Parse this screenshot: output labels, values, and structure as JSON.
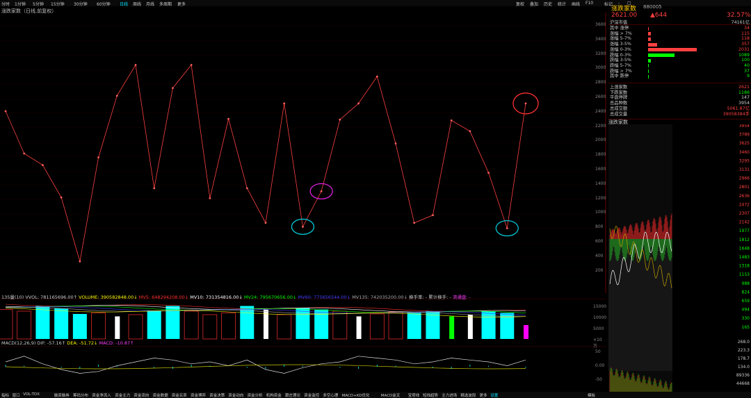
{
  "topbar": {
    "left_items": [
      "分时",
      "1分钟",
      "5分钟",
      "15分钟",
      "30分钟",
      "60分钟",
      "日线",
      "周线",
      "月线",
      "多周期",
      "更多"
    ],
    "right_items": [
      "复权",
      "叠加",
      "历史",
      "统计",
      "画线",
      "F10",
      "标记",
      "-",
      "□"
    ],
    "active_item": "日线"
  },
  "chart_title": "涨跌家数（日线,前复权）",
  "right_axis_ticks": [
    "3600",
    "3400",
    "3200",
    "3000",
    "2800",
    "2600",
    "2400",
    "2200",
    "2000",
    "1800",
    "1600",
    "1400",
    "1200",
    "1000",
    "800",
    "600",
    "400",
    "200"
  ],
  "chart_data": {
    "type": "line",
    "y": [
      2500,
      1950,
      1800,
      1380,
      550,
      1900,
      2700,
      3100,
      1500,
      2800,
      3100,
      1370,
      2400,
      1500,
      1050,
      2600,
      1000,
      1460,
      2390,
      2600,
      2950,
      2080,
      1050,
      1150,
      2380,
      2240,
      1700,
      980,
      2600
    ],
    "ylim": [
      400,
      3600
    ],
    "highlights": [
      {
        "index": 16,
        "color": "#00c8d8"
      },
      {
        "index": 17,
        "color": "#e020e0"
      },
      {
        "index": 27,
        "color": "#00c8d8"
      },
      {
        "index": 28,
        "color": "#ff3030"
      }
    ]
  },
  "volume": {
    "legend": [
      {
        "text": "135量(10)",
        "color": "#cccccc"
      },
      {
        "text": "VVOL: 781165696.00↑",
        "color": "#cccccc"
      },
      {
        "text": "VOLUME: 390582848.00↓",
        "color": "#ffff00"
      },
      {
        "text": "MV5: 648294208.00↓",
        "color": "#ff3030"
      },
      {
        "text": "MV10: 731354816.00↓",
        "color": "#ffffff"
      },
      {
        "text": "MV24: 795670656.00↓",
        "color": "#00ff00"
      },
      {
        "text": "MV60: 775656544.00↓",
        "color": "#4040ff"
      },
      {
        "text": "MV135: 742035200.00↓",
        "color": "#aaaaaa"
      },
      {
        "text": "换手率: -",
        "color": "#cccccc"
      },
      {
        "text": "累计换手: -",
        "color": "#cccccc"
      },
      {
        "text": "流通盘: -",
        "color": "#ff40ff"
      }
    ],
    "bars": [
      {
        "t": "red"
      },
      {
        "t": "red"
      },
      {
        "t": "cyan"
      },
      {
        "t": "cyan"
      },
      {
        "t": "cyan"
      },
      {
        "t": "red"
      },
      {
        "t": "white"
      },
      {
        "t": "red"
      },
      {
        "t": "cyan"
      },
      {
        "t": "cyan"
      },
      {
        "t": "red"
      },
      {
        "t": "red"
      },
      {
        "t": "red"
      },
      {
        "t": "cyan"
      },
      {
        "t": "white"
      },
      {
        "t": "red"
      },
      {
        "t": "cyan"
      },
      {
        "t": "cyan"
      },
      {
        "t": "red"
      },
      {
        "t": "white"
      },
      {
        "t": "red"
      },
      {
        "t": "red"
      },
      {
        "t": "cyan"
      },
      {
        "t": "cyan"
      },
      {
        "t": "green"
      },
      {
        "t": "white"
      },
      {
        "t": "cyan"
      },
      {
        "t": "cyan"
      },
      {
        "t": "magenta"
      }
    ],
    "heights": [
      0.85,
      0.8,
      0.95,
      0.88,
      0.72,
      0.75,
      0.65,
      0.7,
      0.82,
      0.95,
      0.8,
      0.7,
      0.75,
      0.95,
      0.85,
      0.7,
      0.9,
      0.85,
      0.8,
      0.65,
      0.72,
      0.78,
      0.75,
      0.8,
      0.65,
      0.7,
      0.8,
      0.75,
      0.4
    ],
    "axis_ticks": [
      "15000",
      "10000",
      "5000",
      "×10万"
    ]
  },
  "macd": {
    "legend": [
      {
        "text": "MACD(12,26,9) DIF: -57.16↑",
        "color": "#cccccc"
      },
      {
        "text": "DEA: -51.72↓",
        "color": "#ffff00"
      },
      {
        "text": "MACD: -10.87↑",
        "color": "#ff40ff"
      }
    ],
    "dif": [
      40,
      55,
      35,
      20,
      10,
      15,
      30,
      40,
      50,
      45,
      35,
      40,
      30,
      45,
      20,
      10,
      25,
      35,
      40,
      55,
      50,
      45,
      35,
      40,
      50,
      45,
      40,
      30,
      45
    ],
    "axis_ticks": [
      "50",
      "0.00",
      "-50"
    ]
  },
  "right_panel": {
    "name": "涨跌家数",
    "code": "880005",
    "price": "2621.00",
    "change": "▲644",
    "pct": "32.57%",
    "market_cap_label": "沪深市值",
    "market_cap_value": "74161亿",
    "rows": [
      {
        "label": "其中 涨停",
        "value": "34",
        "color": "#ff4040",
        "bar": 0.02
      },
      {
        "label": "涨幅 > 7%",
        "value": "115",
        "color": "#ff4040",
        "bar": 0.06
      },
      {
        "label": "涨幅 5-7%",
        "value": "118",
        "color": "#ff4040",
        "bar": 0.06
      },
      {
        "label": "涨幅 3-5%",
        "value": "357",
        "color": "#ff4040",
        "bar": 0.18
      },
      {
        "label": "涨幅 0-3%",
        "value": "2031",
        "color": "#ff4040",
        "bar": 1.0
      },
      {
        "label": "跌幅 0-3%",
        "value": "1089",
        "color": "#00ff00",
        "bar": 0.54
      },
      {
        "label": "跌幅 3-5%",
        "value": "100",
        "color": "#00ff00",
        "bar": 0.05
      },
      {
        "label": "跌幅 5-7%",
        "value": "40",
        "color": "#00ff00",
        "bar": 0.02
      },
      {
        "label": "跌幅 > 7%",
        "value": "37",
        "color": "#00ff00",
        "bar": 0.02
      },
      {
        "label": "其中 跌停",
        "value": "9",
        "color": "#00ff00",
        "bar": 0.005
      }
    ],
    "stats": [
      {
        "label": "上涨家数",
        "value": "2621",
        "color": "#ff4040"
      },
      {
        "label": "下跌家数",
        "value": "1186",
        "color": "#00ff00"
      },
      {
        "label": "平盘停牌",
        "value": "147",
        "color": "#cccccc"
      },
      {
        "label": "总品种数",
        "value": "3954",
        "color": "#cccccc"
      },
      {
        "label": "总成交额",
        "value": "5061.87亿",
        "color": "#ff4040"
      },
      {
        "label": "总成交量",
        "value": "39058384手",
        "color": "#ff4040"
      }
    ],
    "mini_title": "涨跌家数",
    "mini_axis": [
      "3954",
      "3789",
      "3625",
      "3460",
      "3295",
      "3131",
      "2966",
      "2801",
      "2636",
      "2472",
      "2307",
      "2142",
      "1977",
      "1812",
      "1648",
      "1483",
      "1318",
      "1153",
      "988",
      "824",
      "659",
      "494",
      "330",
      "165"
    ],
    "mini_axis2": [
      "268.0",
      "223.3",
      "178.7",
      "134.0",
      "89336",
      "44668"
    ]
  },
  "bottom_bar": {
    "items": [
      "指标",
      "窗口",
      "VOL-TDX",
      "融资融券",
      "筹码分布",
      "资金净流入",
      "资金主力",
      "资金流向",
      "资金数据",
      "资金买卖",
      "资金博弈",
      "资金决策",
      "资金动向",
      "资金分析",
      "机构资金",
      "跟庄理论",
      "资金监控",
      "多空心理",
      "MACD+KD优化",
      "MACD金叉",
      "宝塔线",
      "短线趋势",
      "主力进场",
      "精选波段",
      "更多",
      "设置"
    ],
    "right": "模板"
  }
}
